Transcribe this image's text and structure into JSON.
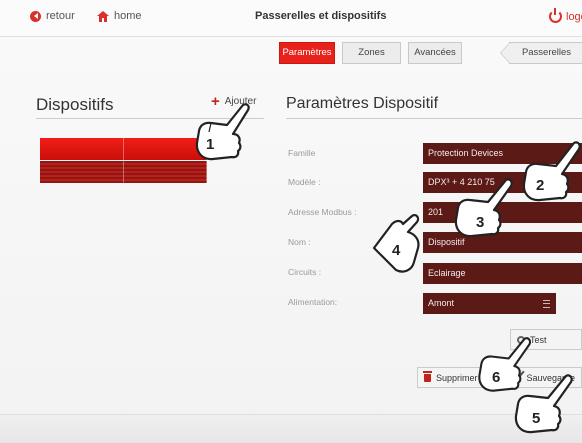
{
  "topbar": {
    "back_label": "retour",
    "home_label": "home",
    "title": "Passerelles et dispositifs",
    "logout_label": "logo"
  },
  "tabs": [
    {
      "label": "Paramètres",
      "active": true
    },
    {
      "label": "Zones",
      "active": false
    },
    {
      "label": "Avancées",
      "active": false
    },
    {
      "label": "Passerelles",
      "active": false
    }
  ],
  "left": {
    "title": "Dispositifs",
    "add_label": "Ajouter"
  },
  "right": {
    "title": "Paramètres Dispositif",
    "fields": [
      {
        "label": "Famille",
        "value": "Protection Devices"
      },
      {
        "label": "Modèle :",
        "value": "DPX³ + 4 210 75"
      },
      {
        "label": "Adresse Modbus :",
        "value": "201"
      },
      {
        "label": "Nom :",
        "value": "Dispositif"
      },
      {
        "label": "Circuits :",
        "value": "Eclairage"
      },
      {
        "label": "Alimentation:",
        "value": "Amont"
      }
    ],
    "test_label": "Test",
    "delete_label": "Supprimer",
    "save_label": "Sauvegarde"
  },
  "callouts": [
    "1",
    "2",
    "3",
    "4",
    "5",
    "6"
  ],
  "colors": {
    "accent_red": "#e8221a",
    "field_bg": "#5c1a17",
    "callout_hand": "#ffffff"
  },
  "icons": [
    "back-arrow-icon",
    "home-icon",
    "power-icon",
    "plus-icon",
    "menu-icon",
    "gear-icon",
    "trash-icon",
    "check-icon",
    "pointing-hand-icon"
  ]
}
